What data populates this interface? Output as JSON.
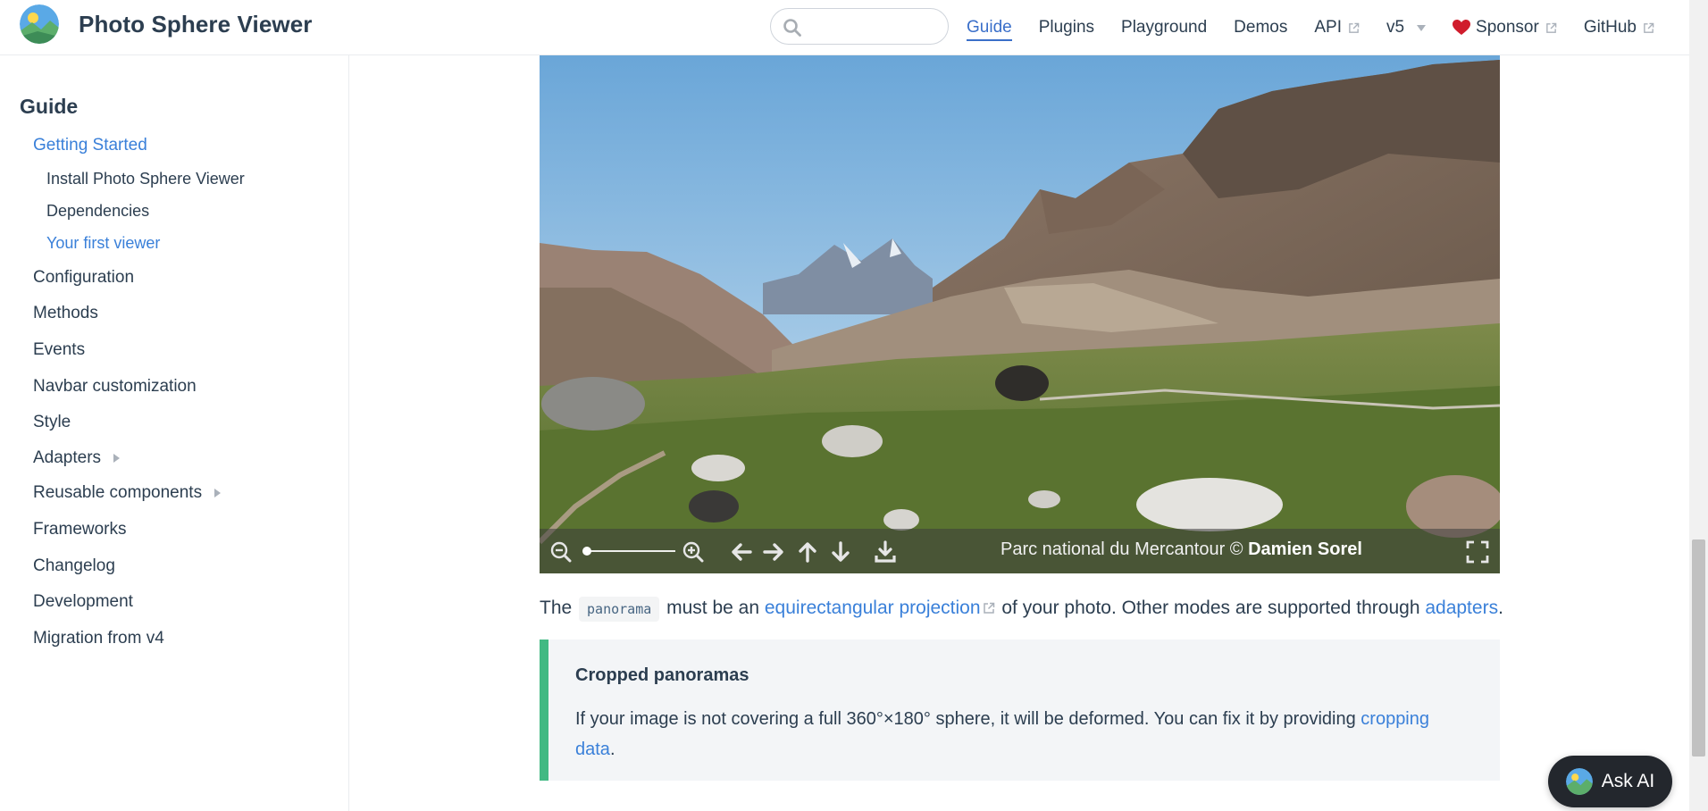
{
  "header": {
    "site_name": "Photo Sphere Viewer",
    "search": {
      "placeholder": "",
      "value": ""
    },
    "nav": [
      {
        "label": "Guide",
        "active": true,
        "external": false
      },
      {
        "label": "Plugins",
        "active": false,
        "external": false
      },
      {
        "label": "Playground",
        "active": false,
        "external": false
      },
      {
        "label": "Demos",
        "active": false,
        "external": false
      },
      {
        "label": "API",
        "active": false,
        "external": true
      },
      {
        "label": "v5",
        "active": false,
        "dropdown": true
      },
      {
        "label": "Sponsor",
        "active": false,
        "external": true,
        "icon": "heart-icon"
      },
      {
        "label": "GitHub",
        "active": false,
        "external": true
      }
    ]
  },
  "sidebar": {
    "heading": "Guide",
    "items": [
      {
        "label": "Getting Started",
        "active": true
      },
      {
        "label": "Install Photo Sphere Viewer",
        "sub": true
      },
      {
        "label": "Dependencies",
        "sub": true
      },
      {
        "label": "Your first viewer",
        "sub": true,
        "active": true
      },
      {
        "label": "Configuration"
      },
      {
        "label": "Methods"
      },
      {
        "label": "Events"
      },
      {
        "label": "Navbar customization"
      },
      {
        "label": "Style"
      },
      {
        "label": "Adapters",
        "expandable": true
      },
      {
        "label": "Reusable components",
        "expandable": true
      },
      {
        "label": "Frameworks"
      },
      {
        "label": "Changelog"
      },
      {
        "label": "Development"
      },
      {
        "label": "Migration from v4"
      }
    ]
  },
  "viewer": {
    "caption_prefix": "Parc national du Mercantour © ",
    "caption_author": "Damien Sorel",
    "buttons": [
      "zoom-out-icon",
      "zoom-in-icon",
      "arrow-left-icon",
      "arrow-right-icon",
      "arrow-up-icon",
      "arrow-down-icon",
      "download-icon",
      "fullscreen-icon"
    ]
  },
  "content": {
    "para_the": "The",
    "para_code": "panorama",
    "para_mid": "must be an",
    "para_link1": "equirectangular projection",
    "para_after": "of your photo. Other modes are supported through",
    "para_link2": "adapters",
    "para_end": ".",
    "tip_title": "Cropped panoramas",
    "tip_text": "If your image is not covering a full 360°×180° sphere, it will be deformed. You can fix it by providing",
    "tip_link": "cropping data",
    "tip_end": "."
  },
  "ask_ai": {
    "label": "Ask AI"
  },
  "colors": {
    "accent": "#3a80d9",
    "tip_border": "#42b983",
    "tip_bg": "#f3f5f7"
  }
}
